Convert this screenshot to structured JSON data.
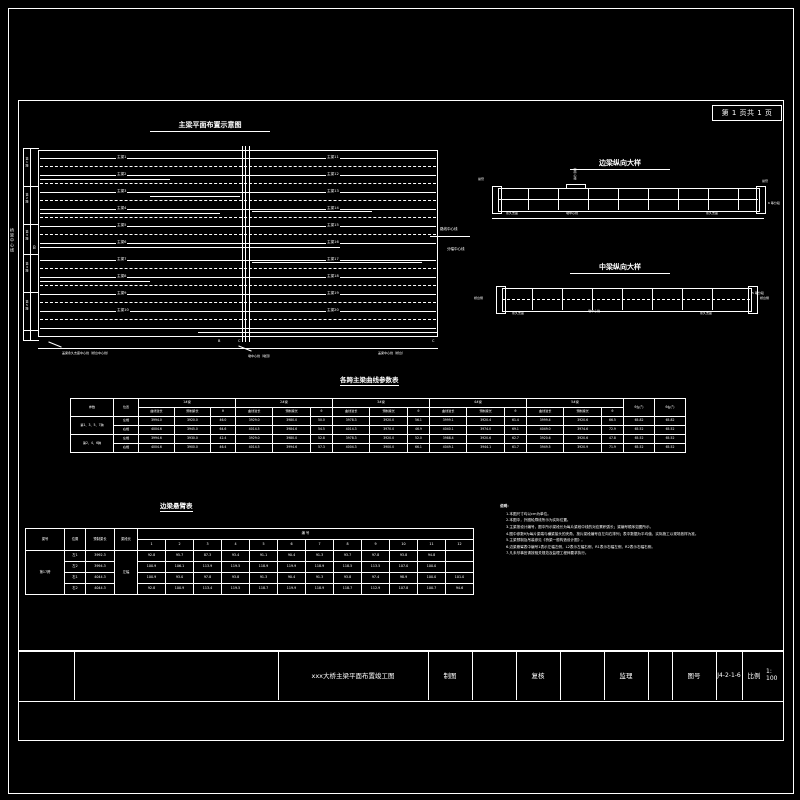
{
  "sheet": {
    "page_badge": "第 1 页共 1 页",
    "units_note": "cm"
  },
  "views": {
    "plan": {
      "title": "主梁平面布置示意图",
      "left_axis_label": "桥梁中心线",
      "left_beams": [
        "主梁1",
        "主梁2",
        "主梁3",
        "主梁4",
        "主梁5",
        "主梁6",
        "主梁7",
        "主梁8",
        "主梁9",
        "主梁10"
      ],
      "right_beams": [
        "主梁11",
        "主梁12",
        "主梁13",
        "主梁14",
        "主梁15",
        "主梁16",
        "主梁17",
        "主梁18",
        "主梁19",
        "主梁20"
      ],
      "right_note": "路线中心线",
      "mid_note": "分幅中心线",
      "bottom_left_label": "盖梁永久支座中心线（桥台中心线）",
      "bottom_mid_label": "墩中心线（墩顶）",
      "bottom_right_label": "盖梁中心线（桥台）",
      "span_marks": [
        "B",
        "C"
      ],
      "left_groups": [
        "第1跨",
        "第2跨",
        "第3跨",
        "第4跨",
        "第5跨"
      ]
    },
    "side_beam": {
      "title": "边梁纵向大样",
      "left_label": "桥台侧",
      "right_label": "桥台侧",
      "mid_label": "墩中心线",
      "end_label_left": "永久支座",
      "end_label_right": "永久支座",
      "corner_label": "悬臂",
      "dim_label": "6 等分段"
    },
    "mid_beam": {
      "title": "中梁纵向大样",
      "left_label": "桥台侧",
      "right_label": "桥台侧",
      "mid_label": "墩中心线",
      "end_label_left": "永久支座",
      "end_label_right": "永久支座",
      "dim_label": "5 等分段"
    }
  },
  "table_curve": {
    "title": "各跨主梁曲线参数表",
    "col_param": "参数",
    "col_pos": "位置",
    "beam_groups": [
      "1#梁",
      "2#梁",
      "3#梁",
      "4#梁",
      "5#梁"
    ],
    "sub_headers": [
      "曲线弦长",
      "预制梁长",
      "θ"
    ],
    "tail_headers": [
      "θ左(°)",
      "θ右(°)"
    ],
    "row_labels": [
      "第1、3、5、7跨",
      "第2、4、6跨"
    ],
    "pos_labels": [
      "左幅",
      "右幅"
    ],
    "rows": [
      {
        "span": "第1、3、5、7跨",
        "pos": "左幅",
        "cells": [
          "3994.0",
          "3920.0",
          "46.0",
          "3929.0",
          "3980.0",
          "50.0",
          "3978.3",
          "3920.0",
          "56.1",
          "3999.1",
          "3920.4",
          "61.4",
          "3999.4",
          "3920.6",
          "66.5"
        ],
        "theta_l": "65.82",
        "theta_r": "65.82"
      },
      {
        "span": "第1、3、5、7跨",
        "pos": "右幅",
        "cells": [
          "4004.6",
          "3945.0",
          "64.6",
          "4014.5",
          "3984.6",
          "54.5",
          "4014.3",
          "3970.0",
          "46.9",
          "4040.1",
          "3974.0",
          "69.1",
          "4049.0",
          "3974.6",
          "72.9"
        ],
        "theta_l": "65.52",
        "theta_r": "65.52"
      },
      {
        "span": "第2、4、6跨",
        "pos": "左幅",
        "cells": [
          "3994.6",
          "3930.0",
          "42.4",
          "3929.0",
          "3980.0",
          "52.8",
          "3978.3",
          "3920.0",
          "52.0",
          "3988.4",
          "3920.6",
          "62.7",
          "3920.6",
          "3920.6",
          "47.8"
        ],
        "theta_l": "65.52",
        "theta_r": "65.52"
      },
      {
        "span": "第2、4、6跨",
        "pos": "右幅",
        "cells": [
          "4004.6",
          "3900.0",
          "46.4",
          "4014.5",
          "3994.6",
          "57.3",
          "4004.3",
          "3900.0",
          "66.1",
          "4049.1",
          "3944.1",
          "61.7",
          "3949.5",
          "3920.9",
          "71.9"
        ],
        "theta_l": "65.52",
        "theta_r": "65.52"
      }
    ]
  },
  "table_cantilever": {
    "title": "边梁悬臂表",
    "headers": [
      "梁号",
      "位置",
      "预制梁长",
      "梁段长",
      "编 号"
    ],
    "num_headers": [
      "1",
      "2",
      "3",
      "4",
      "5",
      "6",
      "7",
      "8",
      "9",
      "10",
      "11",
      "12"
    ],
    "span_label": "第17跨",
    "rows": [
      {
        "beam": "左1",
        "len": "3992.3",
        "seg": "左幅",
        "vals": [
          "92.8",
          "95.7",
          "87.3",
          "93.4",
          "91.1",
          "90.4",
          "91.3",
          "93.7",
          "97.8",
          "93.8",
          "94.8",
          ""
        ]
      },
      {
        "beam": "左2",
        "len": "3994.3",
        "seg": "",
        "vals": [
          "100.9",
          "106.1",
          "113.9",
          "119.5",
          "118.9",
          "119.9",
          "118.9",
          "118.5",
          "113.5",
          "107.0",
          "100.0",
          ""
        ]
      },
      {
        "beam": "右1",
        "len": "4044.3",
        "seg": "",
        "vals": [
          "100.9",
          "93.0",
          "97.8",
          "93.8",
          "91.3",
          "90.4",
          "91.3",
          "93.8",
          "97.4",
          "98.9",
          "100.0",
          "101.0"
        ]
      },
      {
        "beam": "右2",
        "len": "4044.3",
        "seg": "",
        "vals": [
          "92.8",
          "100.9",
          "113.4",
          "119.5",
          "118.7",
          "119.9",
          "118.9",
          "118.7",
          "112.9",
          "107.8",
          "100.7",
          "94.6"
        ]
      }
    ]
  },
  "notes": {
    "head": "说明：",
    "items": [
      "1.本图尺寸均以cm为单位。",
      "2.本图中，外圈轮廓线所示为实际位置。",
      "3.主梁按设计编号，图中所示梁段长为每片梁段中线的对应累积弧长；梁编号顺序如图所示。",
      "4.图中参数θ为每片梁端与横梁接头的夹角，按片梁段编号自左向右排列；表中数据为平均值，实际施工以现场放样为准。",
      "5.主梁预制及吊装参见《桥梁一般构造设计图》。",
      "6.边梁悬臂表中编号1表示左幅左侧，L2表示左幅右侧，R1表示右幅左侧，R2表示右幅右侧。",
      "7.凡未尽事宜请按相关规范及监理工程师要求执行。"
    ]
  },
  "title_block": {
    "project": "xxx大桥主梁平面布置竣工图",
    "drawn_label": "制图",
    "drawn_value": "",
    "check_label": "复核",
    "check_value": "",
    "supervise_label": "监理",
    "supervise_value": "",
    "dwg_no_label": "图号",
    "dwg_no_value": "J4-2-1-6",
    "scale_label": "比例",
    "scale_value": "1: 100"
  }
}
